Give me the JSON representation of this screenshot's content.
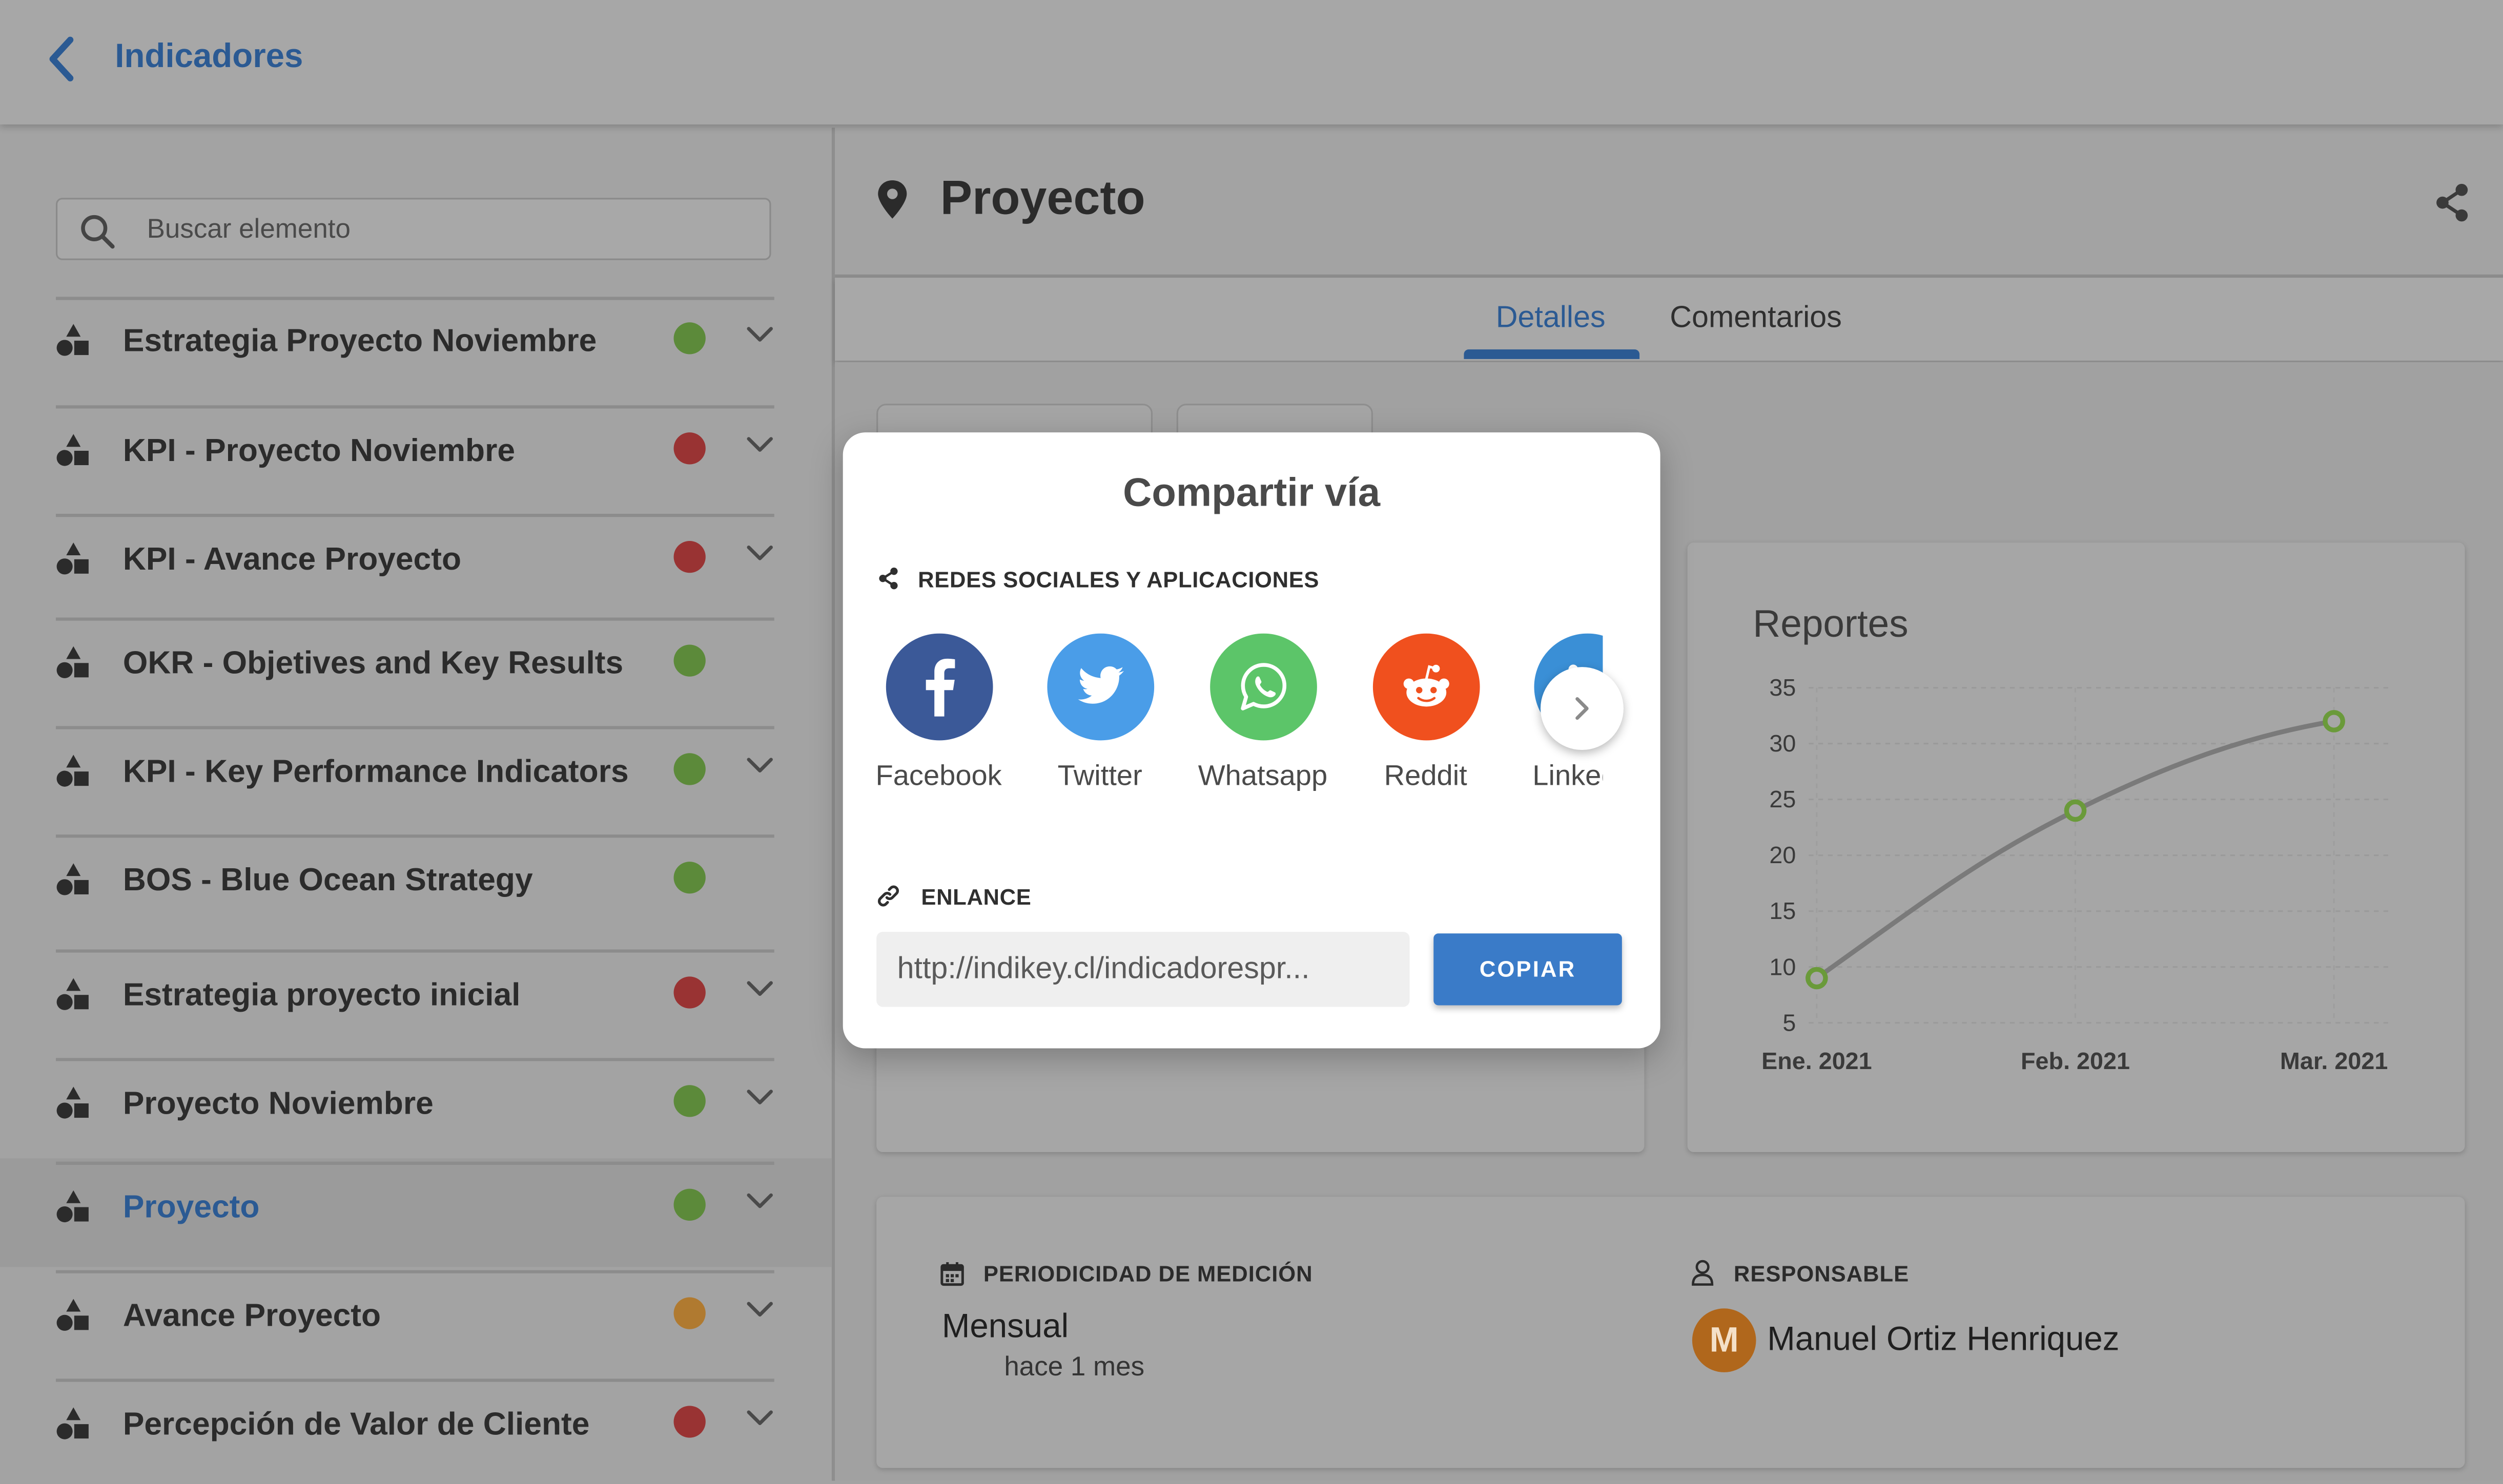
{
  "header": {
    "title": "Indicadores"
  },
  "sidebar": {
    "search_placeholder": "Buscar elemento",
    "items": [
      {
        "label": "Estrategia Proyecto Noviembre",
        "status": "green",
        "chevron": true
      },
      {
        "label": "KPI - Proyecto Noviembre",
        "status": "red",
        "chevron": true
      },
      {
        "label": "KPI - Avance Proyecto",
        "status": "red",
        "chevron": true
      },
      {
        "label": "OKR - Objetives and Key Results",
        "status": "green",
        "chevron": false
      },
      {
        "label": "KPI - Key Performance Indicators",
        "status": "green",
        "chevron": true
      },
      {
        "label": "BOS - Blue Ocean Strategy",
        "status": "green",
        "chevron": false
      },
      {
        "label": "Estrategia proyecto inicial",
        "status": "red",
        "chevron": true
      },
      {
        "label": "Proyecto Noviembre",
        "status": "green",
        "chevron": true
      },
      {
        "label": "Proyecto",
        "status": "green",
        "chevron": true,
        "selected": true
      },
      {
        "label": "Avance Proyecto",
        "status": "orange",
        "chevron": true
      },
      {
        "label": "Percepción de Valor de Cliente",
        "status": "red",
        "chevron": true
      }
    ]
  },
  "status_colors": {
    "green": "#5c8a3a",
    "red": "#993333",
    "orange": "#b07a30"
  },
  "main": {
    "title": "Proyecto",
    "tabs": [
      {
        "label": "Detalles",
        "active": true
      },
      {
        "label": "Comentarios",
        "active": false
      }
    ],
    "periodicidad": {
      "label": "PERIODICIDAD DE MEDICIÓN",
      "value": "Mensual",
      "updated": "hace 1 mes"
    },
    "responsable": {
      "label": "RESPONSABLE",
      "initial": "M",
      "name": "Manuel Ortiz Henriquez"
    }
  },
  "chart_data": {
    "type": "line",
    "title": "Reportes",
    "categories": [
      "Ene. 2021",
      "Feb. 2021",
      "Mar. 2021"
    ],
    "values": [
      9,
      24,
      32
    ],
    "ylim": [
      5,
      35
    ],
    "yticks": [
      5,
      10,
      15,
      20,
      25,
      30,
      35
    ],
    "line_color": "#7a7a7a",
    "point_color": "#6a9a3a",
    "grid": true
  },
  "share_dialog": {
    "title": "Compartir vía",
    "social_section": "REDES SOCIALES Y APLICACIONES",
    "apps": [
      {
        "name": "Facebook",
        "icon": "facebook-icon",
        "color": "#3b5998"
      },
      {
        "name": "Twitter",
        "icon": "twitter-icon",
        "color": "#4a9de8"
      },
      {
        "name": "Whatsapp",
        "icon": "whatsapp-icon",
        "color": "#5cc569"
      },
      {
        "name": "Reddit",
        "icon": "reddit-icon",
        "color": "#f0501e"
      },
      {
        "name": "LinkedIn",
        "icon": "linkedin-icon",
        "color": "#3a8fd6"
      }
    ],
    "link_section": "ENLANCE",
    "link_url": "http://indikey.cl/indicadorespr...",
    "copy_label": "COPIAR"
  }
}
